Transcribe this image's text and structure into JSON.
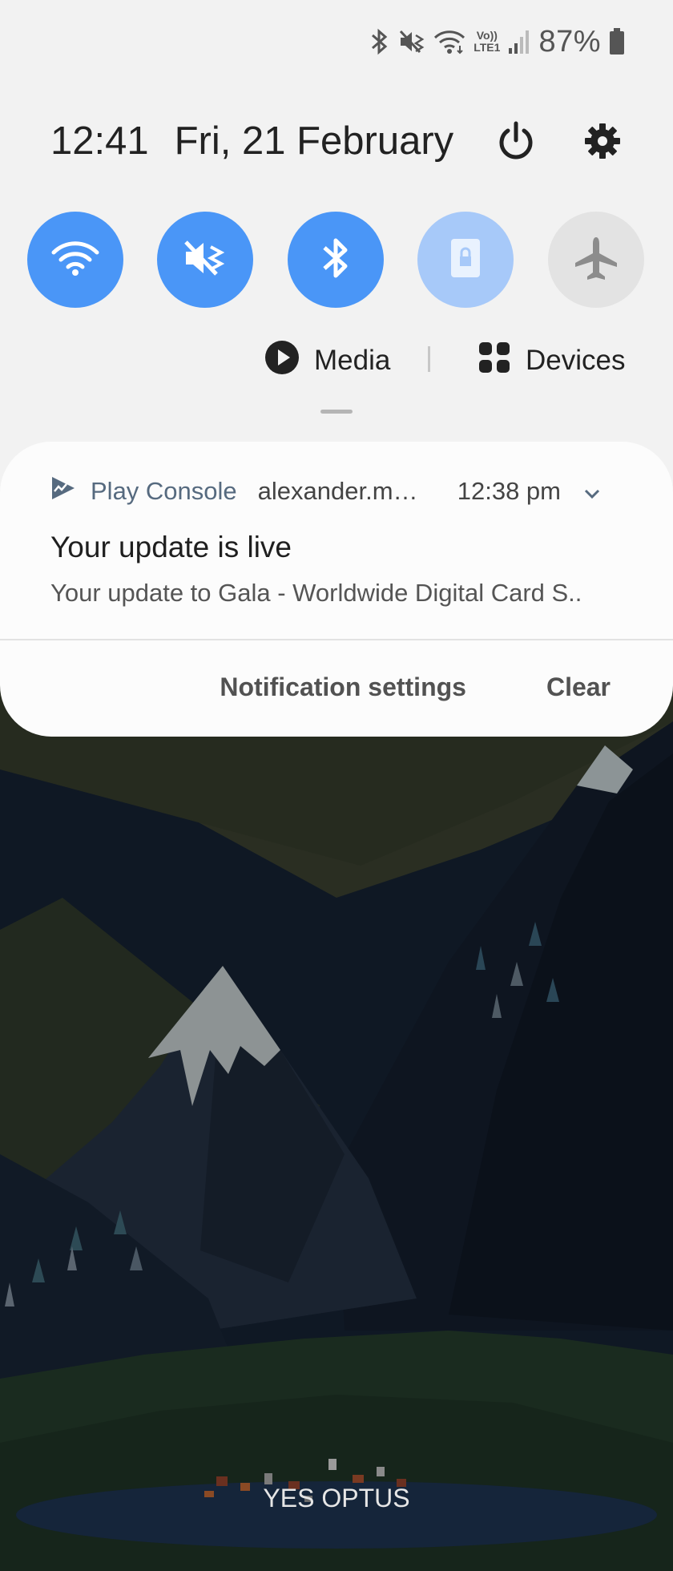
{
  "status_bar": {
    "icons": [
      "bluetooth-icon",
      "mute-icon",
      "wifi-icon",
      "volte-icon",
      "signal-icon",
      "battery-icon"
    ],
    "volte_top": "Vo))",
    "volte_bottom": "LTE1",
    "battery_percent": "87%"
  },
  "header": {
    "time": "12:41",
    "date": "Fri, 21 February",
    "power_icon": "power-icon",
    "settings_icon": "gear-icon"
  },
  "quick_settings": [
    {
      "name": "wifi",
      "icon": "wifi-icon",
      "state": "on"
    },
    {
      "name": "sound",
      "icon": "mute-icon",
      "state": "on"
    },
    {
      "name": "bluetooth",
      "icon": "bluetooth-icon",
      "state": "on"
    },
    {
      "name": "rotation",
      "icon": "rotation-lock-icon",
      "state": "dim"
    },
    {
      "name": "airplane",
      "icon": "airplane-icon",
      "state": "off"
    }
  ],
  "media_bar": {
    "media_label": "Media",
    "devices_label": "Devices"
  },
  "notification": {
    "app_name": "Play Console",
    "account": "alexander.m…",
    "time": "12:38 pm",
    "title": "Your update is live",
    "text": "Your update to Gala - Worldwide Digital Card S..",
    "settings_label": "Notification settings",
    "clear_label": "Clear"
  },
  "carrier": "YES OPTUS",
  "colors": {
    "accent": "#4a96f7",
    "panel_bg": "#f2f2f2",
    "card_bg": "#fcfcfc"
  }
}
